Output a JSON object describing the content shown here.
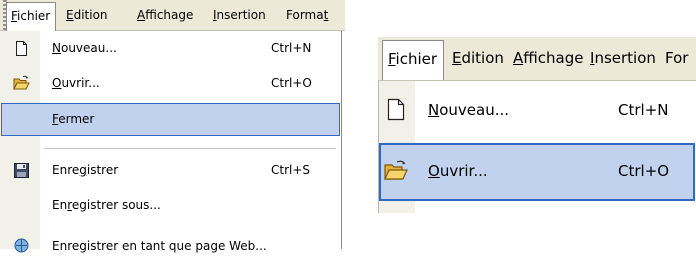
{
  "left_panel": {
    "menubar": {
      "items": [
        {
          "pre": "",
          "key": "F",
          "post": "ichier"
        },
        {
          "pre": "",
          "key": "E",
          "post": "dition"
        },
        {
          "pre": "",
          "key": "A",
          "post": "ffichage"
        },
        {
          "pre": "",
          "key": "I",
          "post": "nsertion"
        },
        {
          "pre": "Forma",
          "key": "t",
          "post": ""
        }
      ]
    },
    "menu": {
      "items": [
        {
          "pre": "",
          "key": "N",
          "post": "ouveau...",
          "shortcut": "Ctrl+N",
          "icon": "new-document-icon"
        },
        {
          "pre": "",
          "key": "O",
          "post": "uvrir...",
          "shortcut": "Ctrl+O",
          "icon": "open-folder-icon"
        },
        {
          "pre": "",
          "key": "F",
          "post": "ermer",
          "shortcut": "",
          "icon": "",
          "selected": true
        },
        {
          "pre": "Enre",
          "key": "g",
          "post": "istrer",
          "shortcut": "Ctrl+S",
          "icon": "save-disk-icon"
        },
        {
          "pre": "En",
          "key": "r",
          "post": "egistrer sous...",
          "shortcut": "",
          "icon": ""
        },
        {
          "pre": "Enregistrer en tant que page Web...",
          "key": "",
          "post": "",
          "shortcut": "",
          "icon": "save-web-icon"
        }
      ]
    }
  },
  "right_panel": {
    "menubar": {
      "items": [
        {
          "pre": "",
          "key": "F",
          "post": "ichier"
        },
        {
          "pre": "",
          "key": "E",
          "post": "dition"
        },
        {
          "pre": "",
          "key": "A",
          "post": "ffichage"
        },
        {
          "pre": "",
          "key": "I",
          "post": "nsertion"
        },
        {
          "pre": "For",
          "key": "",
          "post": ""
        }
      ]
    },
    "menu": {
      "items": [
        {
          "pre": "",
          "key": "N",
          "post": "ouveau...",
          "shortcut": "Ctrl+N",
          "icon": "new-document-icon"
        },
        {
          "pre": "",
          "key": "O",
          "post": "uvrir...",
          "shortcut": "Ctrl+O",
          "icon": "open-folder-icon",
          "selected": true
        }
      ]
    }
  },
  "colors": {
    "menubar_bg": "#ece9d8",
    "icon_gutter": "#f1f0e9",
    "selection_fill": "#c1d2ee",
    "selection_border": "#316ac5"
  }
}
